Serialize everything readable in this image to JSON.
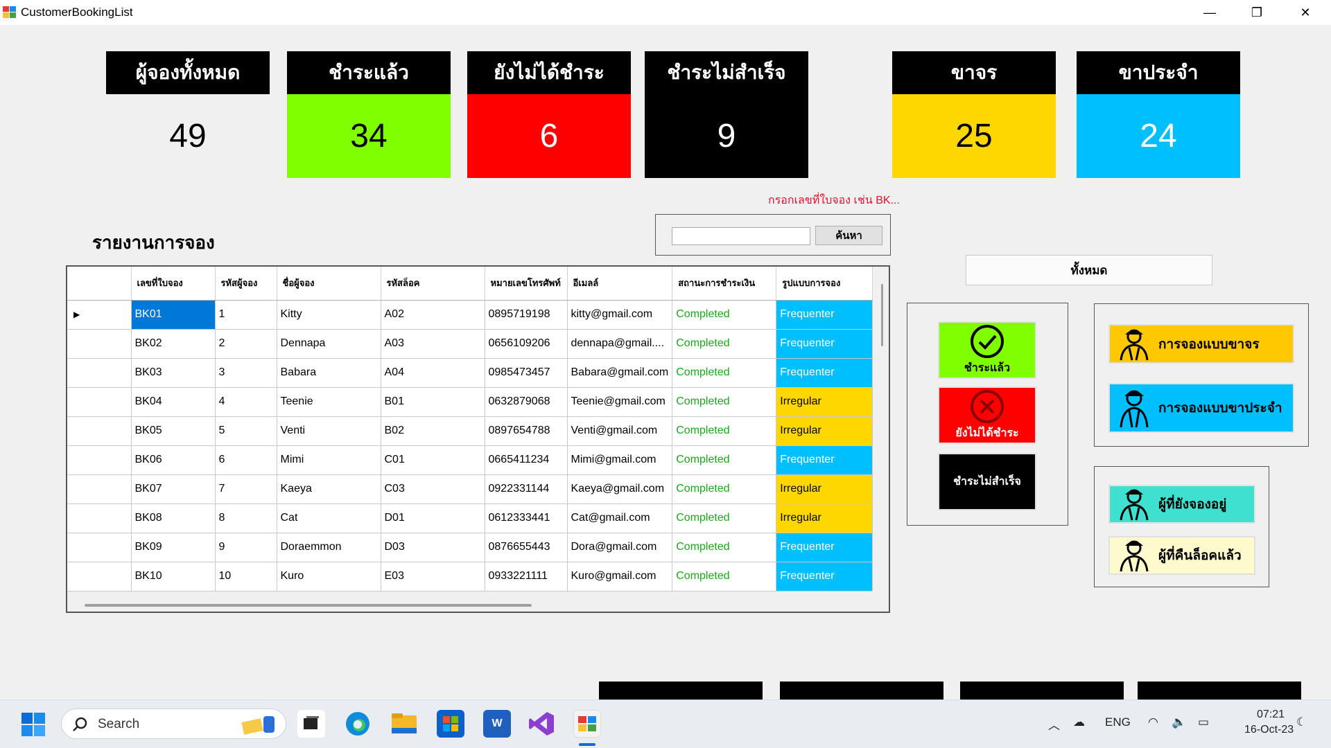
{
  "window": {
    "title": "CustomerBookingList",
    "min": "—",
    "max": "❐",
    "close": "✕"
  },
  "summary": [
    {
      "label": "ผู้จองทั้งหมด",
      "value": "49"
    },
    {
      "label": "ชำระแล้ว",
      "value": "34"
    },
    {
      "label": "ยังไม่ได้ชำระ",
      "value": "6"
    },
    {
      "label": "ชำระไม่สำเร็จ",
      "value": "9"
    },
    {
      "label": "ขาจร",
      "value": "25"
    },
    {
      "label": "ขาประจำ",
      "value": "24"
    }
  ],
  "colors": {
    "green": "#80ff00",
    "red": "#ff0000",
    "black": "#000000",
    "yellow": "#ffd700",
    "cyan": "#00bfff"
  },
  "search": {
    "hint": "กรอกเลขที่ใบจอง เช่น BK...",
    "value": "",
    "button": "ค้นหา"
  },
  "report_title": "รายงานการจอง",
  "all_button": "ทั้งหมด",
  "table": {
    "columns": [
      "เลขที่ใบจอง",
      "รหัสผู้จอง",
      "ชื่อผู้จอง",
      "รหัสล็อค",
      "หมายเลขโทรศัพท์",
      "อีเมลล์",
      "สถานะการชำระเงิน",
      "รูปแบบการจอง"
    ],
    "rows": [
      [
        "BK01",
        "1",
        "Kitty",
        "A02",
        "0895719198",
        "kitty@gmail.com",
        "Completed",
        "Frequenter"
      ],
      [
        "BK02",
        "2",
        "Dennapa",
        "A03",
        "0656109206",
        "dennapa@gmail....",
        "Completed",
        "Frequenter"
      ],
      [
        "BK03",
        "3",
        "Babara",
        "A04",
        "0985473457",
        "Babara@gmail.com",
        "Completed",
        "Frequenter"
      ],
      [
        "BK04",
        "4",
        "Teenie",
        "B01",
        "0632879068",
        "Teenie@gmail.com",
        "Completed",
        "Irregular"
      ],
      [
        "BK05",
        "5",
        "Venti",
        "B02",
        "0897654788",
        "Venti@gmail.com",
        "Completed",
        "Irregular"
      ],
      [
        "BK06",
        "6",
        "Mimi",
        "C01",
        "0665411234",
        "Mimi@gmail.com",
        "Completed",
        "Frequenter"
      ],
      [
        "BK07",
        "7",
        "Kaeya",
        "C03",
        "0922331144",
        "Kaeya@gmail.com",
        "Completed",
        "Irregular"
      ],
      [
        "BK08",
        "8",
        "Cat",
        "D01",
        "0612333441",
        "Cat@gmail.com",
        "Completed",
        "Irregular"
      ],
      [
        "BK09",
        "9",
        "Doraemmon",
        "D03",
        "0876655443",
        "Dora@gmail.com",
        "Completed",
        "Frequenter"
      ],
      [
        "BK10",
        "10",
        "Kuro",
        "E03",
        "0933221111",
        "Kuro@gmail.com",
        "Completed",
        "Frequenter"
      ]
    ]
  },
  "status_buttons": {
    "paid": "ชำระแล้ว",
    "unpaid": "ยังไม่ได้ชำระ",
    "failed": "ชำระไม่สำเร็จ"
  },
  "type_buttons": {
    "irregular": "การจองแบบขาจร",
    "regular": "การจองแบบขาประจำ"
  },
  "lock_buttons": {
    "active": "ผู้ที่ยังจองอยู่",
    "returned": "ผู้ที่คืนล็อคแล้ว"
  },
  "taskbar": {
    "search": "Search",
    "lang": "ENG",
    "time": "07:21",
    "date": "16-Oct-23"
  }
}
